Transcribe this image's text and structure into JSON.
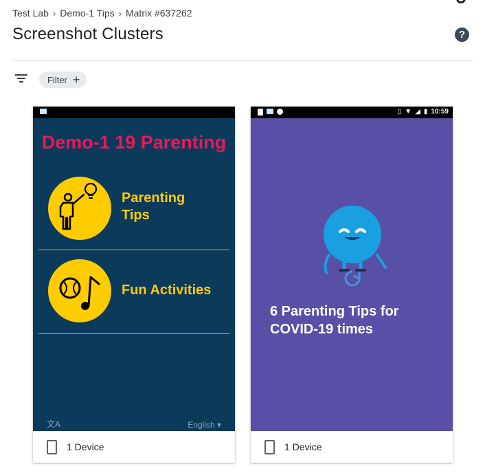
{
  "breadcrumb": {
    "items": [
      "Test Lab",
      "Demo-1 Tips",
      "Matrix #637262"
    ],
    "separator": "›"
  },
  "page": {
    "title": "Screenshot Clusters",
    "help_icon": "?"
  },
  "toolbar": {
    "filter_chip_label": "Filter",
    "filter_chip_add": "+"
  },
  "cards": [
    {
      "screen": {
        "title": "Demo-1 19 Parenting",
        "items": [
          {
            "label_line1": "Parenting",
            "label_line2": "Tips",
            "icon": "parent-idea-icon"
          },
          {
            "label_line1": "Fun Activities",
            "label_line2": "",
            "icon": "ball-music-icon"
          }
        ],
        "language": "English",
        "colors": {
          "background": "#0c3a5b",
          "title": "#e8195a",
          "accent": "#ffcc00"
        }
      },
      "footer_label": "1 Device"
    },
    {
      "screen": {
        "status_time": "10:59",
        "text_line1": "6 Parenting Tips for",
        "text_line2": "COVID-19 times",
        "mascot_icon": "blue-ball-mascot-icon",
        "colors": {
          "background": "#5850a6",
          "mascot": "#1aa0e0"
        }
      },
      "footer_label": "1 Device"
    }
  ]
}
